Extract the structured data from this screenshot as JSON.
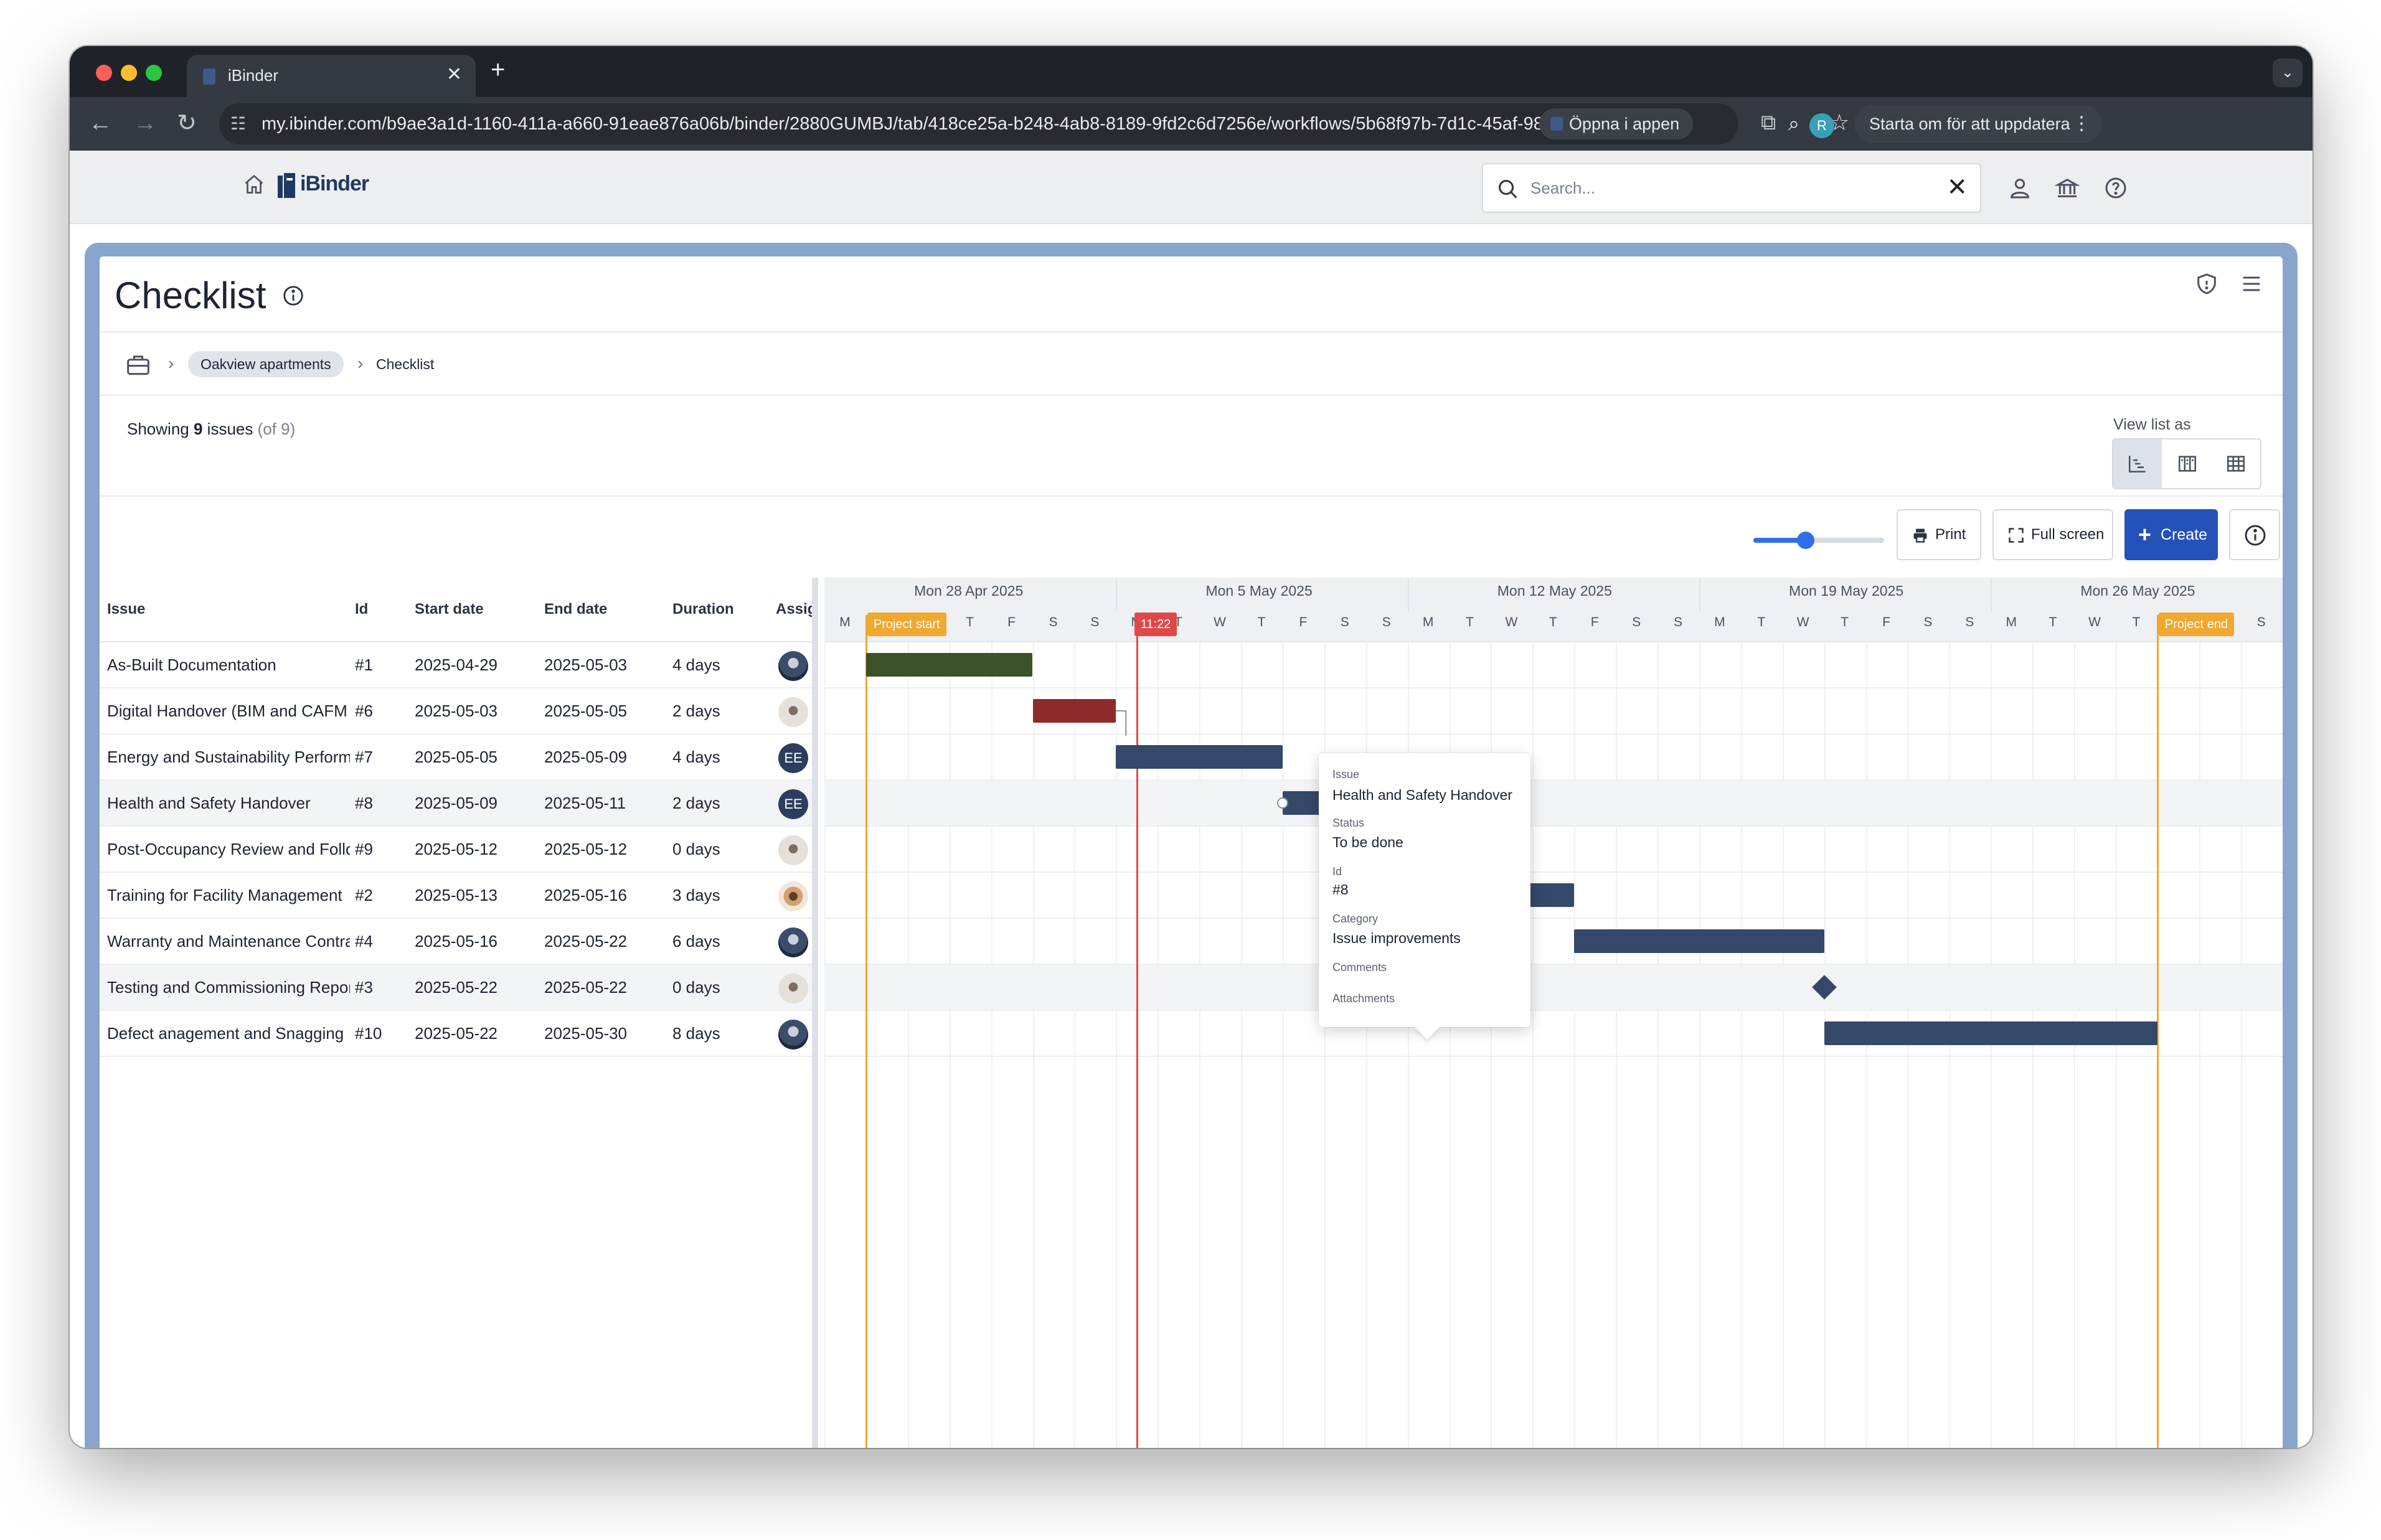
{
  "browser": {
    "tab_title": "iBinder",
    "url": "my.ibinder.com/b9ae3a1d-1160-411a-a660-91eae876a06b/binder/2880GUMBJ/tab/418ce25a-b248-4ab8-8189-9fd2c6d7256e/workflows/5b68f97b-7d1c-45af-98d...",
    "open_in_app": "Öppna i appen",
    "profile_initial": "R",
    "relaunch": "Starta om för att uppdatera"
  },
  "app": {
    "logo": "iBinder",
    "search_placeholder": "Search..."
  },
  "page": {
    "title": "Checklist",
    "breadcrumb": {
      "project": "Oakview apartments",
      "current": "Checklist"
    },
    "showing_prefix": "Showing",
    "showing_count": "9",
    "showing_word": "issues",
    "showing_total": "(of 9)",
    "view_list_as": "View list as"
  },
  "toolbar": {
    "print": "Print",
    "full_screen": "Full screen",
    "create": "Create",
    "zoom_level": 0.4
  },
  "table": {
    "headers": {
      "issue": "Issue",
      "id": "Id",
      "start": "Start date",
      "end": "End date",
      "duration": "Duration",
      "assignee": "Assignee"
    },
    "rows": [
      {
        "issue": "As-Built Documentation",
        "id": "#1",
        "start": "2025-04-29",
        "end": "2025-05-03",
        "duration": "4 days",
        "avatar": "p1",
        "avatar_text": ""
      },
      {
        "issue": "Digital Handover (BIM and CAFM",
        "id": "#6",
        "start": "2025-05-03",
        "end": "2025-05-05",
        "duration": "2 days",
        "avatar": "p2",
        "avatar_text": ""
      },
      {
        "issue": "Energy and Sustainability Performance",
        "id": "#7",
        "start": "2025-05-05",
        "end": "2025-05-09",
        "duration": "4 days",
        "avatar": "ee",
        "avatar_text": "EE"
      },
      {
        "issue": "Health and Safety Handover",
        "id": "#8",
        "start": "2025-05-09",
        "end": "2025-05-11",
        "duration": "2 days",
        "avatar": "ee",
        "avatar_text": "EE"
      },
      {
        "issue": "Post-Occupancy Review and Follow-up",
        "id": "#9",
        "start": "2025-05-12",
        "end": "2025-05-12",
        "duration": "0 days",
        "avatar": "p2",
        "avatar_text": ""
      },
      {
        "issue": "Training for Facility Management",
        "id": "#2",
        "start": "2025-05-13",
        "end": "2025-05-16",
        "duration": "3 days",
        "avatar": "p3",
        "avatar_text": ""
      },
      {
        "issue": "Warranty and Maintenance Contracts",
        "id": "#4",
        "start": "2025-05-16",
        "end": "2025-05-22",
        "duration": "6 days",
        "avatar": "p1",
        "avatar_text": ""
      },
      {
        "issue": "Testing and Commissioning Reports",
        "id": "#3",
        "start": "2025-05-22",
        "end": "2025-05-22",
        "duration": "0 days",
        "avatar": "p2",
        "avatar_text": ""
      },
      {
        "issue": "Defect anagement and Snagging",
        "id": "#10",
        "start": "2025-05-22",
        "end": "2025-05-30",
        "duration": "8 days",
        "avatar": "p1",
        "avatar_text": ""
      }
    ]
  },
  "gantt": {
    "timeline_start": "2025-04-28",
    "days_visible": 35,
    "week_labels": [
      "Mon 28 Apr 2025",
      "Mon 5 May 2025",
      "Mon 12 May 2025",
      "Mon 19 May 2025",
      "Mon 26 May 2025"
    ],
    "day_letters": [
      "M",
      "T",
      "W",
      "T",
      "F",
      "S",
      "S"
    ],
    "project_start": {
      "label": "Project start",
      "date": "2025-04-29"
    },
    "project_end": {
      "label": "Project end",
      "date": "2025-05-30"
    },
    "today": {
      "label": "11:22",
      "date": "2025-05-05.5"
    },
    "tasks": [
      {
        "row": 0,
        "start": "2025-04-29",
        "end": "2025-05-03",
        "color": "#3b5229",
        "milestone": false
      },
      {
        "row": 1,
        "start": "2025-05-03",
        "end": "2025-05-05",
        "color": "#8e2a2a",
        "milestone": false
      },
      {
        "row": 2,
        "start": "2025-05-05",
        "end": "2025-05-09",
        "color": "#34486a",
        "milestone": false
      },
      {
        "row": 3,
        "start": "2025-05-09",
        "end": "2025-05-11",
        "color": "#34486a",
        "milestone": false
      },
      {
        "row": 4,
        "start": "2025-05-12",
        "end": "2025-05-12",
        "color": "#3b5229",
        "milestone": true
      },
      {
        "row": 5,
        "start": "2025-05-13",
        "end": "2025-05-16",
        "color": "#34486a",
        "milestone": false
      },
      {
        "row": 6,
        "start": "2025-05-16",
        "end": "2025-05-22",
        "color": "#34486a",
        "milestone": false
      },
      {
        "row": 7,
        "start": "2025-05-22",
        "end": "2025-05-22",
        "color": "#34486a",
        "milestone": true
      },
      {
        "row": 8,
        "start": "2025-05-22",
        "end": "2025-05-30",
        "color": "#34486a",
        "milestone": false
      }
    ]
  },
  "tooltip": {
    "issue_label": "Issue",
    "issue_value": "Health and Safety Handover",
    "status_label": "Status",
    "status_value": "To be done",
    "id_label": "Id",
    "id_value": "#8",
    "category_label": "Category",
    "category_value": "Issue improvements",
    "comments_label": "Comments",
    "attachments_label": "Attachments"
  }
}
